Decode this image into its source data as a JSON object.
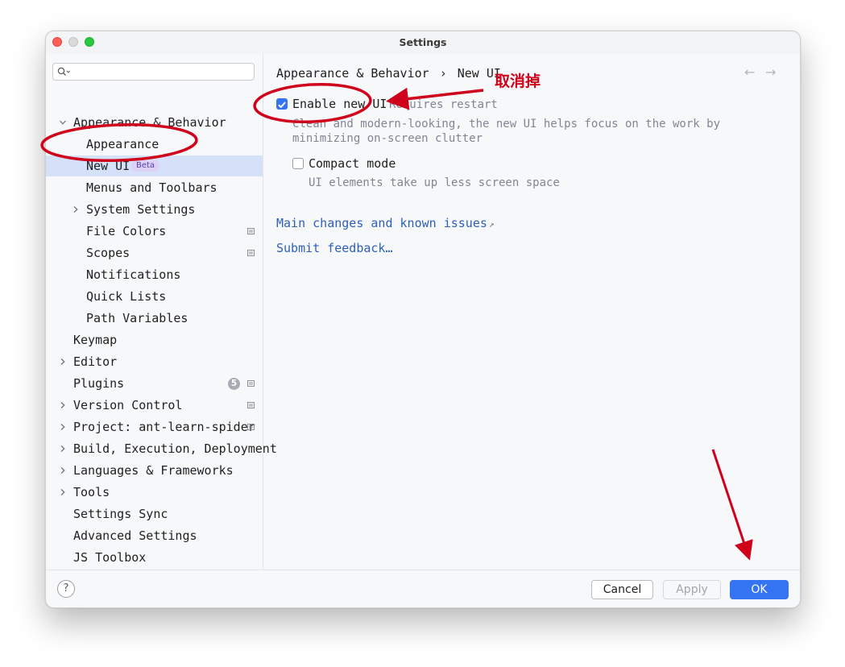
{
  "window": {
    "title": "Settings"
  },
  "search": {
    "placeholder": "",
    "value": ""
  },
  "sidebar": {
    "items": [
      {
        "label": "Appearance & Behavior",
        "expanded": true
      },
      {
        "label": "Appearance"
      },
      {
        "label": "New UI",
        "badge": "Beta",
        "selected": true
      },
      {
        "label": "Menus and Toolbars"
      },
      {
        "label": "System Settings",
        "collapsed": true
      },
      {
        "label": "File Colors"
      },
      {
        "label": "Scopes"
      },
      {
        "label": "Notifications"
      },
      {
        "label": "Quick Lists"
      },
      {
        "label": "Path Variables"
      },
      {
        "label": "Keymap"
      },
      {
        "label": "Editor",
        "collapsed": true
      },
      {
        "label": "Plugins",
        "count": "5"
      },
      {
        "label": "Version Control",
        "collapsed": true
      },
      {
        "label": "Project: ant-learn-spider",
        "collapsed": true
      },
      {
        "label": "Build, Execution, Deployment",
        "collapsed": true
      },
      {
        "label": "Languages & Frameworks",
        "collapsed": true
      },
      {
        "label": "Tools",
        "collapsed": true
      },
      {
        "label": "Settings Sync"
      },
      {
        "label": "Advanced Settings"
      },
      {
        "label": "JS Toolbox"
      }
    ]
  },
  "main": {
    "breadcrumb": {
      "parent": "Appearance & Behavior",
      "separator": "›",
      "current": "New UI"
    },
    "nav": {
      "back": "←",
      "forward": "→"
    },
    "enable_new_ui": {
      "label": "Enable new UI",
      "checked": true,
      "note": "Requires restart",
      "description_line1": "Clean and modern-looking, the new UI helps focus on the work by",
      "description_line2": "minimizing on-screen clutter"
    },
    "compact_mode": {
      "label": "Compact mode",
      "checked": false,
      "description": "UI elements take up less screen space"
    },
    "links": {
      "main_changes": "Main changes and known issues",
      "main_changes_icon": "↗",
      "feedback": "Submit feedback…"
    }
  },
  "footer": {
    "help": "?",
    "cancel": "Cancel",
    "apply": "Apply",
    "ok": "OK"
  },
  "annotation": {
    "text": "取消掉",
    "color": "#d0021b"
  },
  "colors": {
    "accent": "#3574f0",
    "selection": "#d5e1f8",
    "link": "#2e5fb8"
  }
}
